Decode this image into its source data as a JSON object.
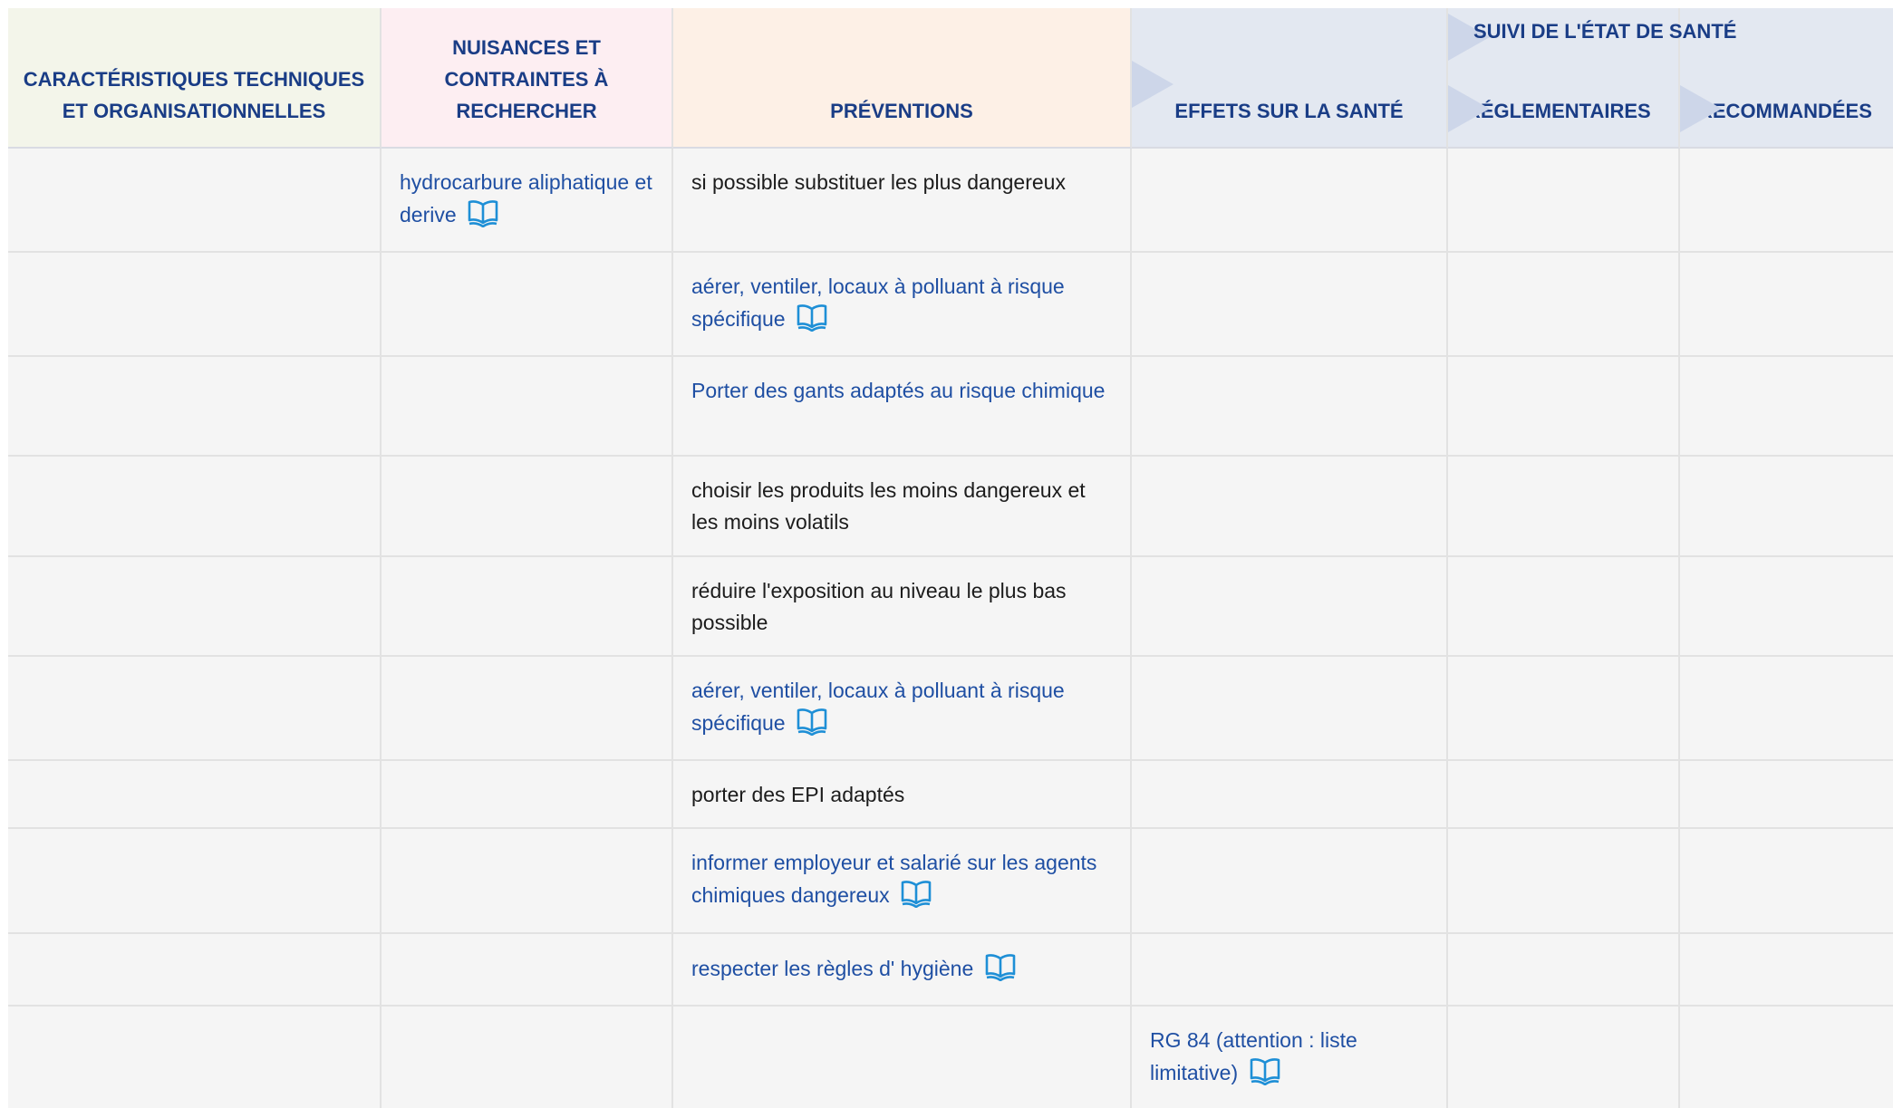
{
  "headers": {
    "tech": "CARACTÉRISTIQUES TECHNIQUES ET ORGANISATIONNELLES",
    "nuisances": "NUISANCES ET CONTRAINTES À RECHERCHER",
    "preventions": "PRÉVENTIONS",
    "effets": "EFFETS SUR LA SANTÉ",
    "suivi_group": "SUIVI DE L'ÉTAT DE SANTÉ",
    "reglementaires": "RÉGLEMENTAIRES",
    "recommandees": "RECOMMANDÉES"
  },
  "rows": [
    {
      "nuisance": "hydrocarbure aliphatique et derive",
      "nuisance_link": true,
      "prevention": "si possible substituer les plus dangereux",
      "prevention_link": false
    },
    {
      "prevention": "aérer, ventiler, locaux à polluant à risque spécifique",
      "prevention_link": true,
      "book": true
    },
    {
      "prevention": "Porter des gants adaptés au risque chimique",
      "prevention_link": true,
      "book": false
    },
    {
      "prevention": "choisir les produits les moins dangereux et les moins volatils",
      "prevention_link": false
    },
    {
      "prevention": "réduire l'exposition au niveau le plus bas possible",
      "prevention_link": false
    },
    {
      "prevention": "aérer, ventiler, locaux à polluant à risque spécifique",
      "prevention_link": true,
      "book": true
    },
    {
      "prevention": "porter des EPI adaptés",
      "prevention_link": false
    },
    {
      "prevention": "informer employeur et salarié sur les agents chimiques dangereux",
      "prevention_link": true,
      "book": true
    },
    {
      "prevention": "respecter les règles d' hygiène",
      "prevention_link": true,
      "book": true
    },
    {
      "effet": "RG 84 (attention : liste limitative)",
      "effet_link": true,
      "book": true
    }
  ],
  "colors": {
    "header_text": "#1a3d86",
    "link_text": "#1f4fa3",
    "book_icon": "#1e8fd6",
    "cell_bg": "#f5f5f5"
  },
  "icons": {
    "book": "book-open-icon",
    "arrow": "chevron-arrow-icon"
  }
}
